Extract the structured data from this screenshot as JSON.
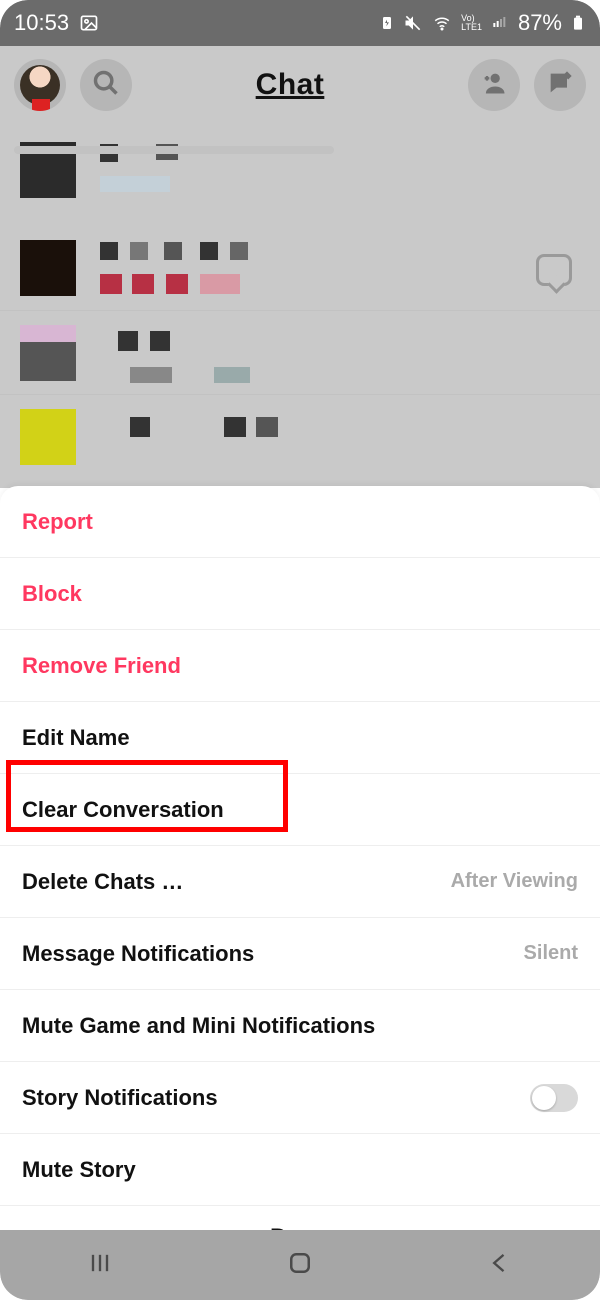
{
  "status": {
    "time": "10:53",
    "battery_pct": "87%"
  },
  "header": {
    "title": "Chat"
  },
  "sheet": {
    "report": "Report",
    "block": "Block",
    "remove_friend": "Remove Friend",
    "edit_name": "Edit Name",
    "clear_conversation": "Clear Conversation",
    "delete_chats": "Delete Chats …",
    "delete_chats_value": "After Viewing",
    "msg_notif": "Message Notifications",
    "msg_notif_value": "Silent",
    "mute_game": "Mute Game and Mini Notifications",
    "story_notif": "Story Notifications",
    "mute_story": "Mute Story",
    "done": "Done"
  }
}
